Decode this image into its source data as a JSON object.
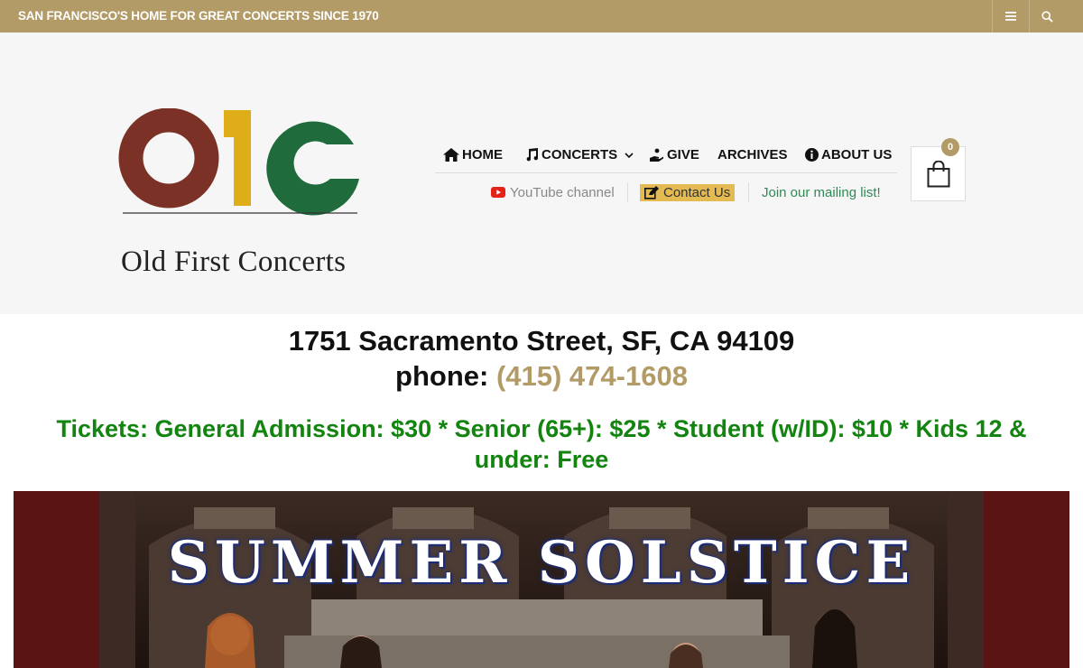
{
  "topbar": {
    "tagline": "SAN FRANCISCO'S HOME FOR GREAT CONCERTS SINCE 1970",
    "menu_icon": "hamburger-icon",
    "search_icon": "search-icon"
  },
  "logo": {
    "letters": "O1C",
    "text": "Old First Concerts",
    "colors": [
      "#7b3126",
      "#dfad17",
      "#1f6b3c"
    ]
  },
  "nav": {
    "items": [
      {
        "label": "HOME",
        "icon": "home-icon"
      },
      {
        "label": "CONCERTS",
        "icon": "music-note-icon",
        "has_dropdown": true
      },
      {
        "label": "GIVE",
        "icon": "hand-give-icon"
      },
      {
        "label": "ARCHIVES"
      },
      {
        "label": "ABOUT US",
        "icon": "info-icon"
      }
    ]
  },
  "subnav": {
    "youtube": "YouTube channel",
    "contact": "Contact Us",
    "mailing": "Join our mailing list!"
  },
  "cart": {
    "count": "0"
  },
  "content": {
    "address": "1751 Sacramento Street, SF, CA 94109",
    "phone_label": "phone: ",
    "phone_number": "(415) 474-1608",
    "tickets": "Tickets: General Admission: $30 * Senior (65+): $25 * Student (w/ID): $10 * Kids 12 & under: Free"
  },
  "banner": {
    "title": "SUMMER SOLSTICE"
  },
  "colors": {
    "accent": "#b39b67",
    "tickets_green": "#13840f",
    "mailing_green": "#2f8a55",
    "contact_bg": "#e3bb52",
    "youtube_red": "#e62117"
  }
}
